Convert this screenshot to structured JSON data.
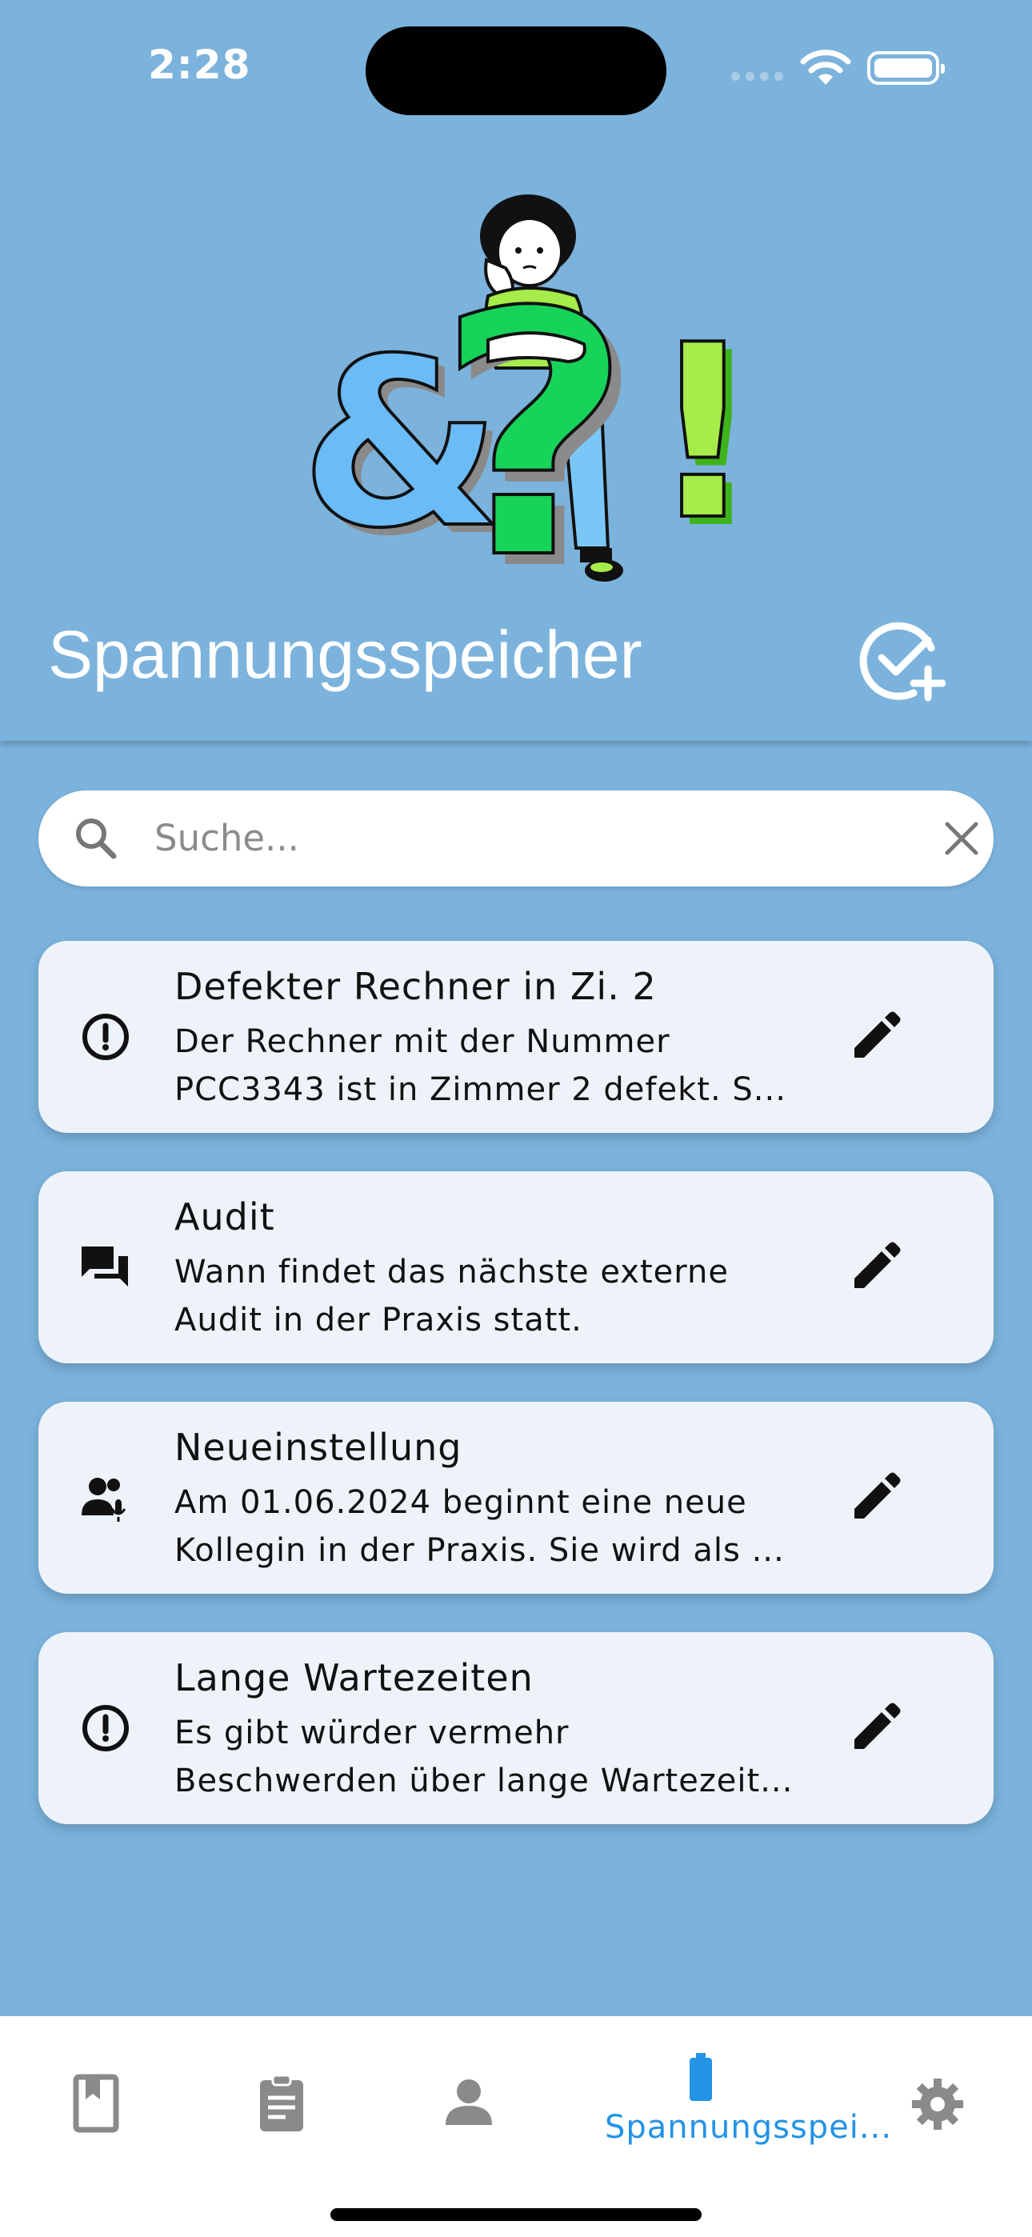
{
  "status_bar": {
    "time": "2:28"
  },
  "header": {
    "title": "Spannungsspeicher"
  },
  "search": {
    "placeholder": "Suche..."
  },
  "cards": [
    {
      "icon": "alert-circle-icon",
      "title": "Defekter Rechner in Zi. 2",
      "line1": "Der Rechner mit der Nummer",
      "line2": "PCC3343 ist in Zimmer 2 defekt. S..."
    },
    {
      "icon": "chat-bubbles-icon",
      "title": "Audit",
      "line1": "Wann findet das nächste externe",
      "line2": "Audit in der Praxis statt."
    },
    {
      "icon": "person-voice-icon",
      "title": "Neueinstellung",
      "line1": "Am 01.06.2024 beginnt eine neue",
      "line2": "Kollegin in der Praxis. Sie wird als ..."
    },
    {
      "icon": "alert-circle-icon",
      "title": "Lange Wartezeiten",
      "line1": "Es gibt würder vermehr",
      "line2": "Beschwerden über lange Wartezeit..."
    }
  ],
  "bottom_nav": {
    "items": [
      {
        "icon": "bookmark-book-icon",
        "label": ""
      },
      {
        "icon": "clipboard-icon",
        "label": ""
      },
      {
        "icon": "person-icon",
        "label": ""
      },
      {
        "icon": "battery-icon",
        "label": "Spannungsspei..."
      },
      {
        "icon": "gear-icon",
        "label": ""
      }
    ],
    "active_index": 3
  },
  "colors": {
    "background": "#7bb3dd",
    "card": "#edf3f8",
    "accent": "#2393e6",
    "inactive_icon": "#8a8a8a"
  }
}
